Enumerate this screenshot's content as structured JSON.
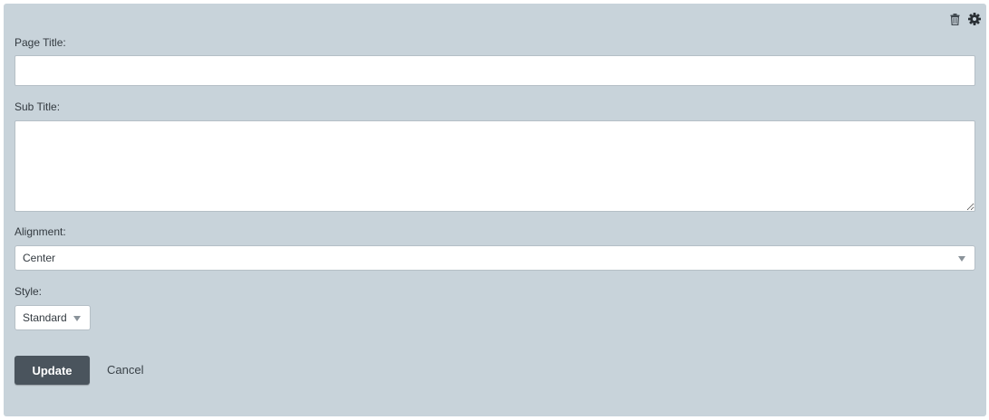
{
  "panel": {
    "tools": {
      "delete_icon": "trash-icon",
      "settings_icon": "gear-icon"
    }
  },
  "form": {
    "page_title": {
      "label": "Page Title:",
      "value": "",
      "placeholder": ""
    },
    "sub_title": {
      "label": "Sub Title:",
      "value": "",
      "placeholder": ""
    },
    "alignment": {
      "label": "Alignment:",
      "selected": "Center"
    },
    "style": {
      "label": "Style:",
      "selected": "Standard"
    }
  },
  "actions": {
    "update_label": "Update",
    "cancel_label": "Cancel"
  },
  "colors": {
    "panel_bg": "#c8d3da",
    "primary_button": "#4a545d",
    "text": "#333a40"
  }
}
